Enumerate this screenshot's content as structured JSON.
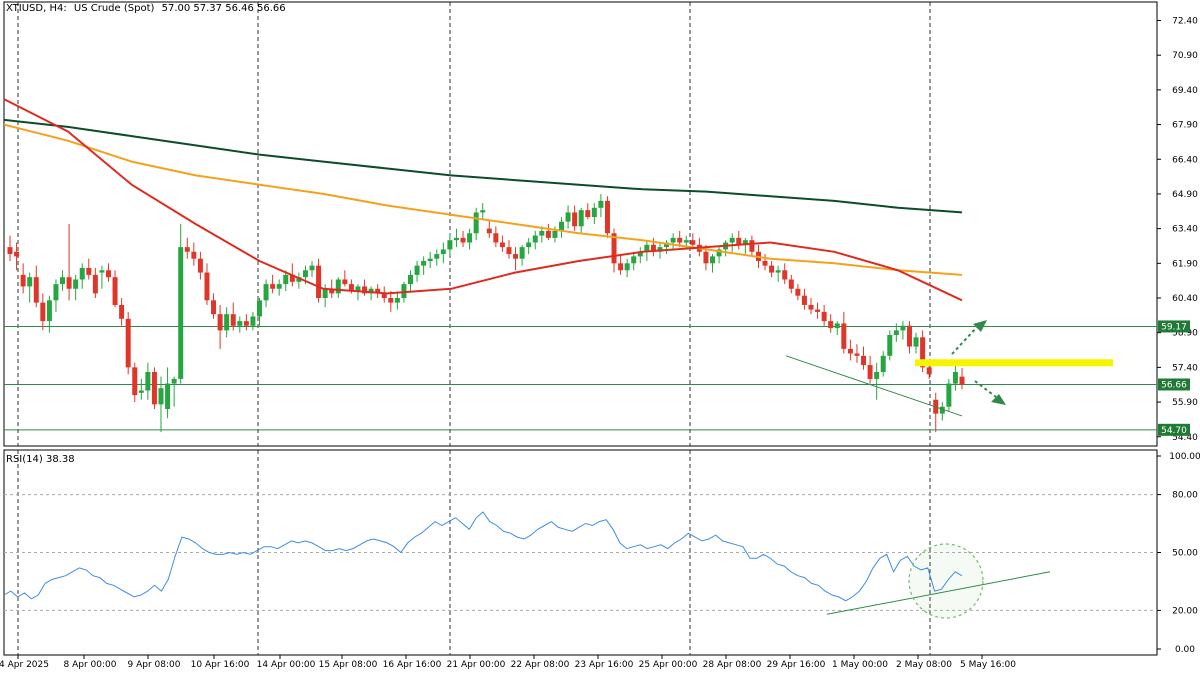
{
  "header": {
    "symbol": "XTIUSD, H4:",
    "name": "US Crude (Spot)",
    "ohlc": "57.00 57.37 56.46 56.66"
  },
  "rsi_header": "RSI(14) 38.38",
  "chart_data": [
    {
      "type": "candlestick",
      "ylim": [
        54.0,
        73.2
      ],
      "price_axis_ticks": [
        "72.40",
        "70.90",
        "69.40",
        "67.90",
        "66.40",
        "64.90",
        "63.40",
        "61.90",
        "60.40",
        "58.90",
        "57.40",
        "55.90",
        "54.40"
      ],
      "price_tags": [
        {
          "label": "59.17",
          "value": 59.17,
          "color": "#1f7a35"
        },
        {
          "label": "56.66",
          "value": 56.66,
          "color": "#1f7a35"
        },
        {
          "label": "54.70",
          "value": 54.7,
          "color": "#1f7a35"
        }
      ],
      "horizontal_lines": [
        59.17,
        56.66,
        54.7
      ],
      "x_labels": [
        "4 Apr 2025",
        "8 Apr 00:00",
        "9 Apr 08:00",
        "10 Apr 16:00",
        "14 Apr 00:00",
        "15 Apr 08:00",
        "16 Apr 16:00",
        "21 Apr 00:00",
        "22 Apr 08:00",
        "23 Apr 16:00",
        "25 Apr 00:00",
        "28 Apr 08:00",
        "29 Apr 16:00",
        "1 May 00:00",
        "2 May 08:00",
        "5 May 16:00"
      ],
      "candles": [
        [
          62.6,
          63.1,
          62.0,
          62.3
        ],
        [
          62.4,
          62.8,
          61.6,
          62.2
        ],
        [
          61.4,
          61.9,
          60.6,
          60.9
        ],
        [
          60.9,
          61.5,
          60.2,
          61.3
        ],
        [
          61.3,
          61.8,
          60.0,
          60.2
        ],
        [
          60.2,
          60.6,
          59.0,
          59.4
        ],
        [
          59.4,
          60.5,
          58.9,
          60.3
        ],
        [
          60.3,
          61.2,
          59.8,
          61.0
        ],
        [
          61.0,
          61.6,
          60.7,
          61.3
        ],
        [
          61.3,
          63.6,
          60.3,
          60.8
        ],
        [
          60.8,
          61.4,
          60.3,
          61.2
        ],
        [
          61.2,
          61.9,
          60.8,
          61.7
        ],
        [
          61.7,
          62.1,
          61.2,
          61.4
        ],
        [
          61.4,
          61.7,
          60.4,
          60.6
        ],
        [
          61.5,
          61.8,
          60.8,
          61.6
        ],
        [
          61.6,
          61.9,
          61.1,
          61.3
        ],
        [
          61.3,
          61.6,
          60.0,
          60.1
        ],
        [
          60.1,
          60.4,
          59.2,
          59.5
        ],
        [
          59.5,
          59.8,
          57.1,
          57.4
        ],
        [
          57.4,
          57.6,
          55.9,
          56.2
        ],
        [
          56.3,
          56.9,
          56.0,
          56.4
        ],
        [
          56.4,
          57.6,
          56.0,
          57.2
        ],
        [
          57.2,
          57.4,
          55.6,
          55.8
        ],
        [
          55.8,
          57.0,
          54.6,
          56.5
        ],
        [
          55.6,
          57.4,
          55.2,
          56.7
        ],
        [
          56.7,
          57.0,
          55.7,
          56.9
        ],
        [
          56.9,
          63.6,
          56.7,
          62.6
        ],
        [
          62.6,
          63.0,
          62.1,
          62.4
        ],
        [
          62.4,
          62.8,
          61.8,
          62.1
        ],
        [
          62.1,
          62.4,
          61.2,
          61.5
        ],
        [
          61.5,
          61.9,
          60.1,
          60.3
        ],
        [
          60.3,
          60.6,
          59.5,
          59.7
        ],
        [
          59.7,
          60.1,
          58.2,
          59.0
        ],
        [
          59.0,
          60.0,
          58.7,
          59.7
        ],
        [
          59.7,
          60.2,
          59.0,
          59.2
        ],
        [
          59.2,
          59.6,
          58.9,
          59.4
        ],
        [
          59.4,
          59.7,
          59.0,
          59.2
        ],
        [
          59.2,
          59.8,
          59.0,
          59.6
        ],
        [
          59.6,
          60.4,
          59.2,
          60.3
        ],
        [
          60.3,
          61.2,
          60.0,
          61.0
        ],
        [
          61.0,
          61.4,
          60.6,
          60.8
        ],
        [
          60.8,
          61.2,
          60.5,
          61.0
        ],
        [
          61.0,
          61.6,
          60.7,
          61.4
        ],
        [
          61.4,
          61.9,
          60.9,
          61.1
        ],
        [
          61.1,
          61.5,
          60.8,
          61.3
        ],
        [
          61.3,
          61.8,
          61.0,
          61.6
        ],
        [
          61.6,
          62.0,
          61.3,
          61.8
        ],
        [
          61.8,
          62.1,
          60.2,
          60.4
        ],
        [
          60.4,
          61.0,
          60.0,
          60.8
        ],
        [
          60.8,
          61.2,
          60.4,
          60.6
        ],
        [
          60.6,
          61.3,
          60.4,
          61.2
        ],
        [
          61.2,
          61.6,
          60.9,
          61.0
        ],
        [
          61.0,
          61.2,
          60.6,
          60.7
        ],
        [
          60.7,
          61.0,
          60.3,
          60.9
        ],
        [
          60.9,
          61.2,
          60.5,
          60.6
        ],
        [
          60.6,
          60.9,
          60.3,
          60.8
        ],
        [
          60.8,
          61.0,
          60.4,
          60.6
        ],
        [
          60.6,
          60.9,
          60.2,
          60.4
        ],
        [
          60.4,
          60.7,
          59.8,
          60.2
        ],
        [
          60.2,
          60.6,
          59.9,
          60.4
        ],
        [
          60.4,
          61.1,
          60.2,
          61.0
        ],
        [
          61.0,
          61.6,
          60.7,
          61.4
        ],
        [
          61.4,
          62.0,
          61.1,
          61.8
        ],
        [
          61.8,
          62.2,
          61.4,
          62.0
        ],
        [
          62.0,
          62.4,
          61.7,
          62.1
        ],
        [
          62.1,
          62.5,
          61.8,
          62.3
        ],
        [
          62.3,
          62.8,
          61.9,
          62.5
        ],
        [
          62.5,
          63.2,
          62.2,
          62.9
        ],
        [
          62.9,
          63.4,
          62.6,
          63.0
        ],
        [
          63.0,
          63.3,
          62.6,
          62.8
        ],
        [
          62.8,
          63.4,
          62.5,
          63.2
        ],
        [
          63.2,
          64.3,
          62.9,
          64.1
        ],
        [
          64.1,
          64.5,
          63.8,
          64.2
        ],
        [
          63.4,
          63.8,
          63.0,
          63.2
        ],
        [
          63.2,
          63.5,
          62.6,
          62.8
        ],
        [
          62.8,
          63.1,
          62.4,
          62.6
        ],
        [
          62.6,
          62.9,
          62.1,
          62.3
        ],
        [
          62.3,
          62.6,
          61.6,
          62.1
        ],
        [
          62.1,
          62.7,
          61.8,
          62.6
        ],
        [
          62.6,
          63.0,
          62.3,
          62.8
        ],
        [
          62.8,
          63.3,
          62.5,
          63.1
        ],
        [
          63.1,
          63.5,
          62.8,
          63.3
        ],
        [
          63.3,
          63.6,
          62.9,
          63.0
        ],
        [
          63.0,
          63.5,
          62.8,
          63.3
        ],
        [
          63.3,
          63.9,
          63.0,
          63.7
        ],
        [
          63.7,
          64.4,
          63.4,
          64.1
        ],
        [
          64.1,
          64.4,
          63.3,
          63.5
        ],
        [
          63.5,
          64.3,
          63.2,
          64.2
        ],
        [
          64.2,
          64.5,
          63.8,
          63.9
        ],
        [
          63.9,
          64.5,
          63.6,
          64.3
        ],
        [
          64.3,
          64.9,
          63.9,
          64.6
        ],
        [
          64.6,
          64.8,
          63.0,
          63.2
        ],
        [
          63.2,
          63.4,
          61.5,
          61.9
        ],
        [
          61.9,
          62.3,
          61.4,
          61.6
        ],
        [
          61.6,
          62.1,
          61.3,
          61.9
        ],
        [
          61.9,
          62.4,
          61.6,
          62.2
        ],
        [
          62.2,
          62.6,
          61.9,
          62.4
        ],
        [
          62.4,
          62.9,
          62.0,
          62.7
        ],
        [
          62.7,
          63.0,
          62.2,
          62.4
        ],
        [
          62.4,
          62.8,
          62.1,
          62.6
        ],
        [
          62.6,
          62.9,
          62.3,
          62.8
        ],
        [
          62.8,
          63.2,
          62.5,
          63.0
        ],
        [
          63.0,
          63.3,
          62.6,
          62.8
        ],
        [
          62.8,
          63.1,
          62.5,
          62.9
        ],
        [
          62.9,
          63.2,
          62.5,
          62.7
        ],
        [
          62.7,
          63.0,
          62.2,
          62.4
        ],
        [
          62.4,
          62.7,
          61.6,
          61.9
        ],
        [
          61.9,
          62.3,
          61.5,
          62.2
        ],
        [
          62.2,
          62.6,
          61.9,
          62.5
        ],
        [
          62.5,
          62.9,
          62.2,
          62.8
        ],
        [
          62.8,
          63.2,
          62.4,
          63.0
        ],
        [
          63.0,
          63.3,
          62.5,
          62.7
        ],
        [
          62.7,
          63.0,
          62.3,
          62.9
        ],
        [
          62.9,
          63.1,
          62.2,
          62.4
        ],
        [
          62.4,
          62.7,
          61.7,
          62.0
        ],
        [
          62.0,
          62.3,
          61.6,
          61.8
        ],
        [
          61.8,
          62.0,
          61.3,
          61.5
        ],
        [
          61.5,
          61.8,
          61.1,
          61.6
        ],
        [
          61.6,
          61.9,
          61.0,
          61.2
        ],
        [
          61.2,
          61.4,
          60.6,
          60.8
        ],
        [
          60.8,
          61.0,
          60.3,
          60.5
        ],
        [
          60.5,
          60.8,
          59.9,
          60.1
        ],
        [
          60.1,
          60.4,
          59.7,
          59.9
        ],
        [
          59.9,
          60.2,
          59.5,
          59.8
        ],
        [
          59.8,
          60.1,
          59.2,
          59.4
        ],
        [
          59.4,
          59.7,
          58.9,
          59.1
        ],
        [
          59.1,
          59.4,
          58.8,
          59.3
        ],
        [
          59.3,
          59.8,
          58.0,
          58.2
        ],
        [
          58.2,
          58.6,
          57.7,
          58.0
        ],
        [
          58.0,
          58.4,
          57.6,
          57.9
        ],
        [
          57.9,
          58.3,
          57.3,
          57.5
        ],
        [
          57.5,
          57.9,
          56.7,
          56.9
        ],
        [
          56.9,
          57.6,
          56.0,
          57.2
        ],
        [
          57.2,
          58.1,
          57.0,
          57.9
        ],
        [
          57.9,
          59.0,
          57.7,
          58.8
        ],
        [
          58.8,
          59.3,
          58.5,
          59.0
        ],
        [
          59.0,
          59.4,
          58.6,
          59.2
        ],
        [
          59.2,
          59.4,
          58.0,
          58.3
        ],
        [
          58.3,
          58.9,
          58.0,
          58.7
        ],
        [
          58.7,
          59.0,
          57.2,
          57.4
        ],
        [
          57.4,
          57.7,
          56.9,
          57.1
        ],
        [
          56.0,
          56.3,
          54.6,
          55.4
        ],
        [
          55.4,
          55.9,
          55.1,
          55.7
        ],
        [
          55.7,
          56.9,
          55.5,
          56.7
        ],
        [
          56.7,
          57.5,
          56.4,
          57.2
        ],
        [
          57.0,
          57.37,
          56.46,
          56.66
        ]
      ],
      "sma_dark_green": [
        68.1,
        67.8,
        67.4,
        67.0,
        66.6,
        66.3,
        66.0,
        65.7,
        65.5,
        65.3,
        65.1,
        65.0,
        64.8,
        64.6,
        64.3,
        64.1
      ],
      "sma_orange": [
        67.9,
        67.2,
        66.3,
        65.7,
        65.3,
        64.9,
        64.4,
        64.0,
        63.6,
        63.2,
        62.9,
        62.5,
        62.1,
        61.9,
        61.6,
        61.4
      ],
      "sma_red": [
        69.0,
        67.6,
        65.3,
        63.6,
        62.0,
        60.8,
        60.6,
        60.8,
        61.5,
        62.0,
        62.4,
        62.6,
        62.8,
        62.4,
        61.6,
        60.3
      ],
      "annotations": {
        "resistance_zone_value": 57.6,
        "falling_trendline": [
          [
            56.9,
            57.9
          ],
          [
            61.1,
            55.3
          ]
        ]
      }
    },
    {
      "type": "line",
      "title": "RSI(14) 38.38",
      "ylim": [
        0,
        100
      ],
      "ticks": [
        "100.00",
        "80.00",
        "50.00",
        "20.00",
        "0.00"
      ],
      "grid_levels": [
        80,
        50,
        20
      ],
      "values": [
        28,
        30,
        27,
        29,
        26,
        28,
        34,
        36,
        37,
        38,
        40,
        42,
        41,
        38,
        37,
        34,
        33,
        31,
        29,
        27,
        28,
        30,
        33,
        30,
        36,
        48,
        58,
        57,
        55,
        52,
        50,
        49,
        49,
        50,
        49,
        50,
        49,
        51,
        53,
        53,
        52,
        54,
        56,
        55,
        56,
        55,
        53,
        51,
        51,
        52,
        51,
        52,
        54,
        56,
        57,
        56,
        55,
        53,
        50,
        55,
        58,
        60,
        63,
        66,
        64,
        66,
        68,
        65,
        62,
        68,
        71,
        66,
        64,
        61,
        60,
        58,
        57,
        59,
        62,
        64,
        66,
        63,
        62,
        61,
        63,
        65,
        64,
        66,
        67,
        62,
        55,
        52,
        53,
        54,
        52,
        53,
        54,
        52,
        55,
        57,
        60,
        58,
        56,
        57,
        59,
        56,
        55,
        54,
        53,
        47,
        47,
        49,
        47,
        44,
        43,
        40,
        38,
        37,
        34,
        33,
        30,
        28,
        27,
        25,
        27,
        30,
        35,
        42,
        47,
        49,
        40,
        46,
        48,
        43,
        41,
        42,
        30,
        31,
        36,
        40,
        38
      ],
      "trendline": [
        [
          0.73,
          18
        ],
        [
          0.93,
          40
        ]
      ]
    }
  ],
  "colors": {
    "bull": "#26a641",
    "bear": "#e0362a",
    "sma_long": "#0b4d2a",
    "sma_mid": "#f4a21b",
    "sma_short": "#dd2c1f",
    "rsi": "#3d8ee8",
    "level": "#2f8a4a",
    "zone": "#f5f500",
    "tag_bg": "#1f7a35"
  }
}
